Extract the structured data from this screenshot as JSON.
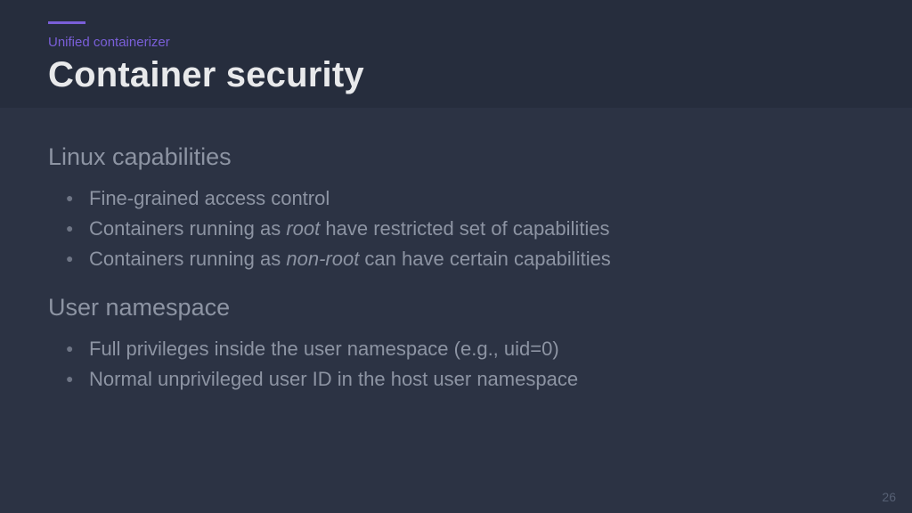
{
  "header": {
    "category": "Unified containerizer",
    "title": "Container security"
  },
  "sections": [
    {
      "heading": "Linux capabilities",
      "bullets": [
        {
          "pre": "Fine-grained access control",
          "em": "",
          "post": ""
        },
        {
          "pre": "Containers running as ",
          "em": "root",
          "post": " have restricted set of capabilities"
        },
        {
          "pre": "Containers running as ",
          "em": "non-root",
          "post": " can have certain capabilities"
        }
      ]
    },
    {
      "heading": "User namespace",
      "bullets": [
        {
          "pre": "Full privileges inside the user namespace (e.g., uid=0)",
          "em": "",
          "post": ""
        },
        {
          "pre": "Normal unprivileged user ID in the host user namespace",
          "em": "",
          "post": ""
        }
      ]
    }
  ],
  "page_number": "26"
}
